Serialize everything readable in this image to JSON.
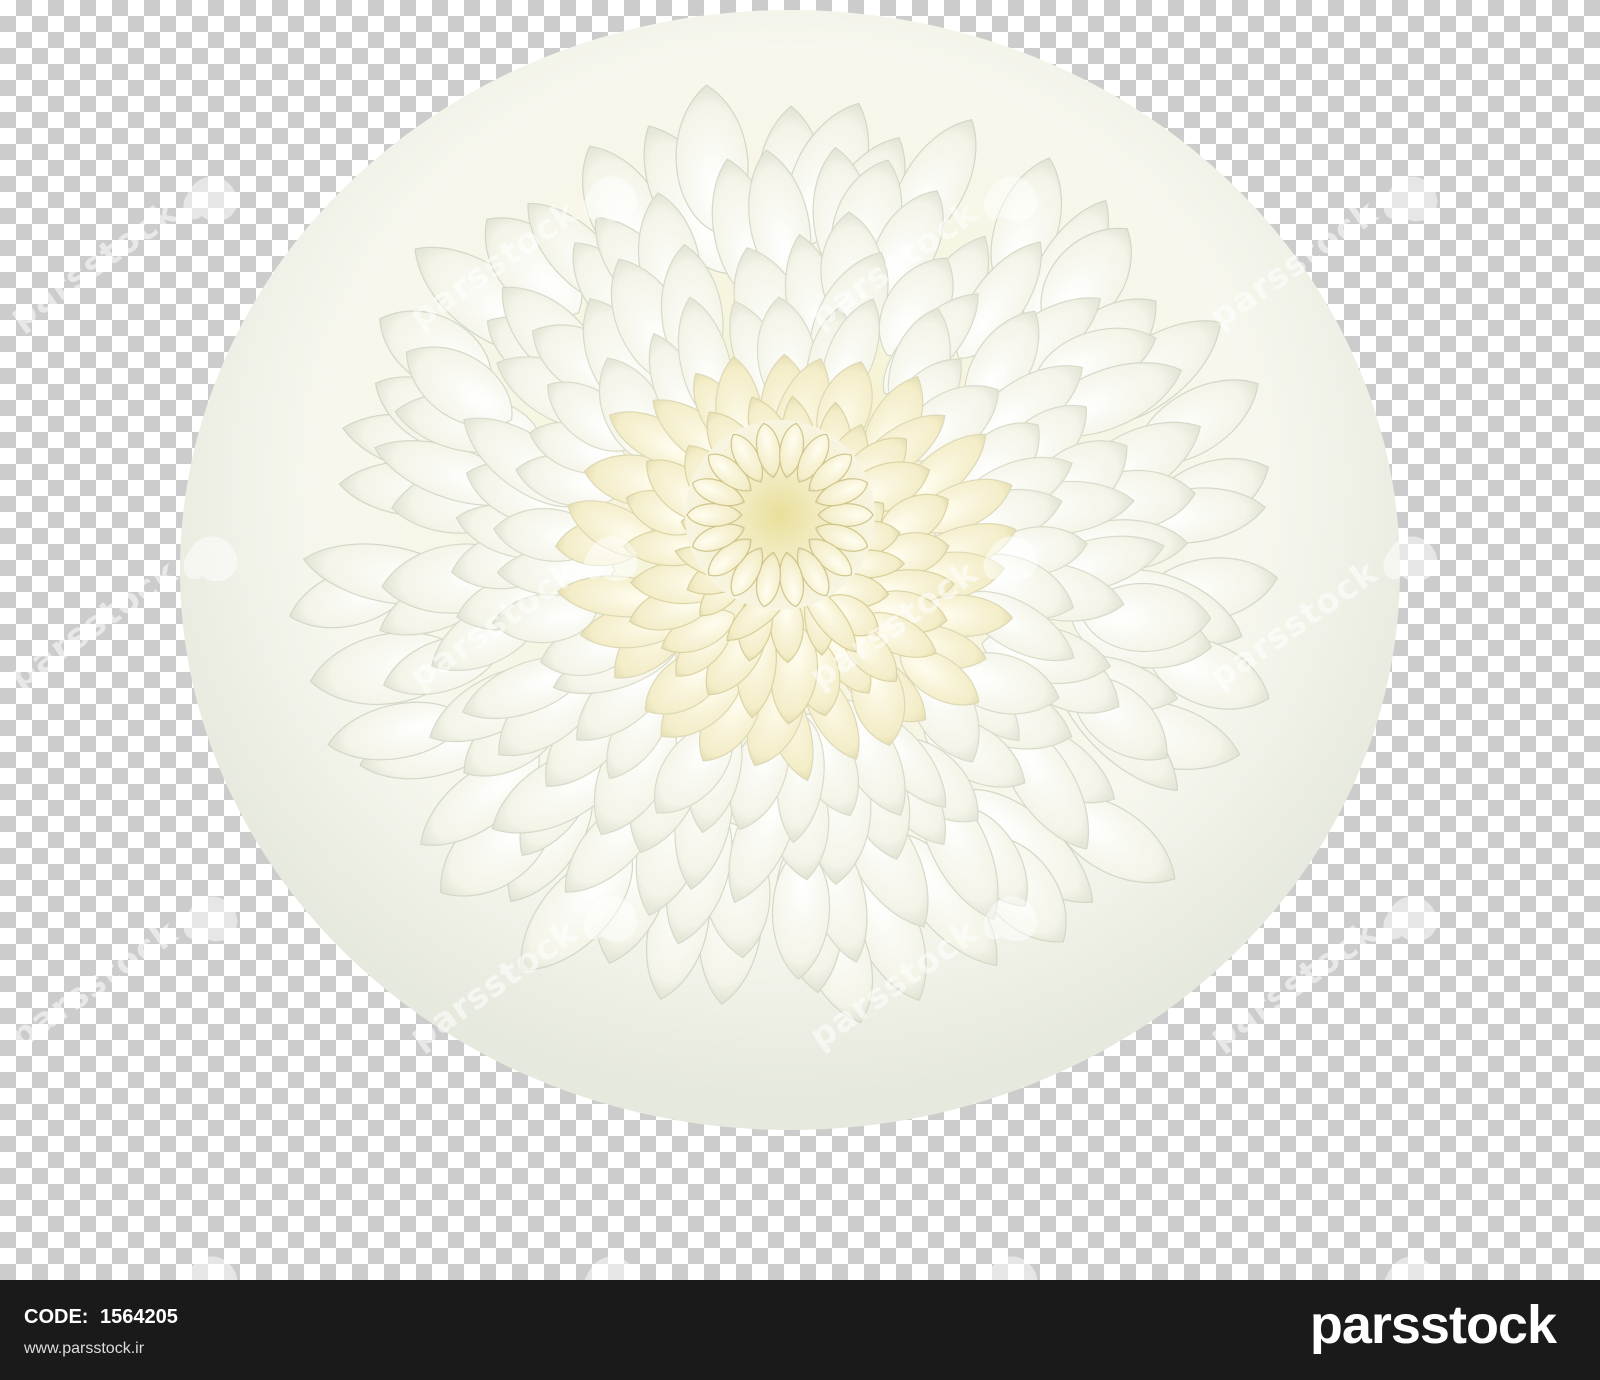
{
  "image": {
    "subject_colors": {
      "petal": "#f6f6ea",
      "petal_shadow": "#dcdcc8",
      "center": "#f2edc0",
      "checker_dark": "#cccccc",
      "checker_light": "#ffffff",
      "footer_bg": "#1a1a1a"
    },
    "watermark": {
      "text": "parsstock",
      "logo_icon": "parsstock-logo-icon"
    }
  },
  "footer": {
    "code_label": "CODE:",
    "code_value": "1564205",
    "website": "www.parsstock.ir",
    "brand": "parsstock"
  }
}
